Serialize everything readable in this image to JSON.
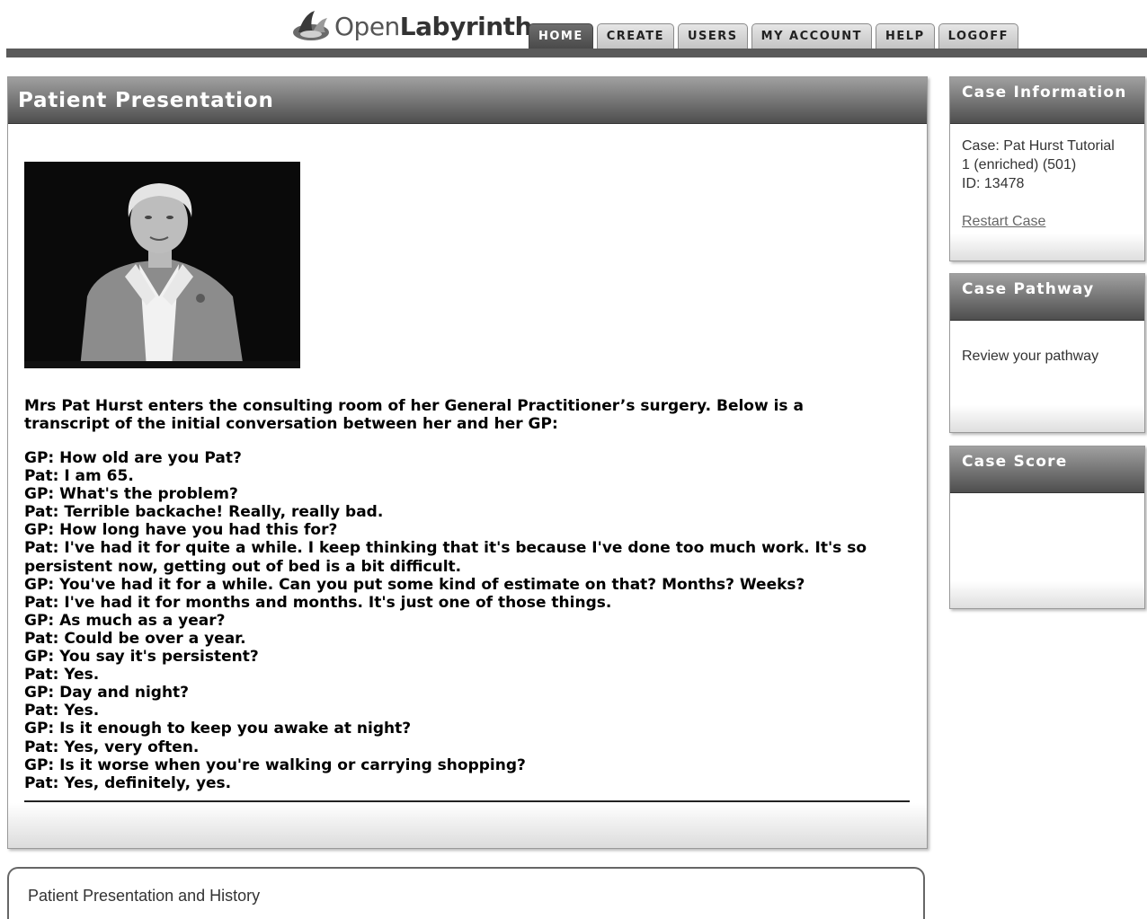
{
  "header": {
    "logo_text_light": "Open",
    "logo_text_bold": "Labyrinth",
    "nav": [
      {
        "label": "HOME",
        "active": true
      },
      {
        "label": "CREATE",
        "active": false
      },
      {
        "label": "USERS",
        "active": false
      },
      {
        "label": "MY ACCOUNT",
        "active": false
      },
      {
        "label": "HELP",
        "active": false
      },
      {
        "label": "LOGOFF",
        "active": false
      }
    ]
  },
  "main": {
    "title": "Patient Presentation",
    "intro": "Mrs Pat Hurst enters the consulting room of her General Practitioner’s surgery. Below is a transcript of the initial conversation between her and her GP:",
    "transcript": [
      "GP: How old are you Pat?",
      "Pat: I am 65.",
      "GP: What's the problem?",
      "Pat: Terrible backache! Really, really bad.",
      "GP: How long have you had this for?",
      "Pat: I've had it for quite a while. I keep thinking that it's because I've done too much work. It's so persistent now, getting out of bed is a bit difficult.",
      "GP: You've had it for a while. Can you put some kind of estimate on that? Months? Weeks?",
      "Pat: I've had it for months and months. It's just one of those things.",
      "GP: As much as a year?",
      "Pat: Could be over a year.",
      "GP: You say it's persistent?",
      "Pat: Yes.",
      "GP: Day and night?",
      "Pat: Yes.",
      "GP: Is it enough to keep you awake at night?",
      "Pat: Yes, very often.",
      "GP: Is it worse when you're walking or carrying shopping?",
      "Pat: Yes, definitely, yes."
    ]
  },
  "sidebar": {
    "case_information": {
      "title": "Case Information",
      "case_line_1": "Case: Pat Hurst Tutorial",
      "case_line_2": "1 (enriched) (501)",
      "id_line": "ID: 13478",
      "restart_label": "Restart Case"
    },
    "case_pathway": {
      "title": "Case Pathway",
      "review_label": "Review your pathway"
    },
    "case_score": {
      "title": "Case Score"
    }
  },
  "bottom": {
    "section_label": "Patient Presentation and History"
  }
}
